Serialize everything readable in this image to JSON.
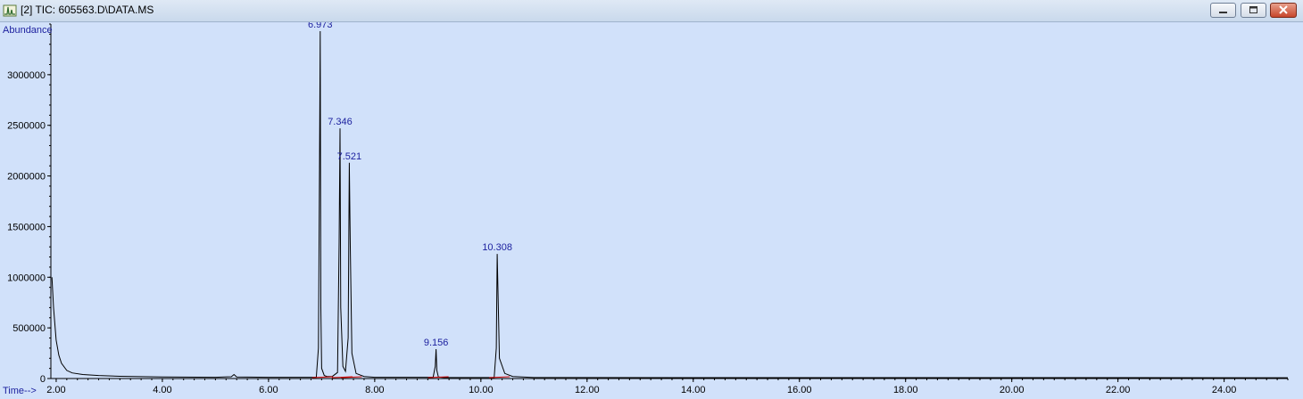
{
  "window": {
    "title": "[2] TIC: 605563.D\\DATA.MS",
    "icon": "chromatogram-app-icon",
    "controls": [
      "minimize",
      "restore",
      "close"
    ]
  },
  "colors": {
    "background": "#d1e1fa",
    "trace": "#000000",
    "labels": "#1b1f9e",
    "baseline_marks": "#cc0000"
  },
  "chart_data": {
    "type": "line",
    "title": "",
    "ylabel": "Abundance",
    "xlabel": "Time-->",
    "xlim": [
      1.9,
      25.2
    ],
    "ylim": [
      0,
      3500000
    ],
    "x_ticks": [
      "2.00",
      "4.00",
      "6.00",
      "8.00",
      "10.00",
      "12.00",
      "14.00",
      "16.00",
      "18.00",
      "20.00",
      "22.00",
      "24.00"
    ],
    "y_ticks": [
      "0",
      "500000",
      "1000000",
      "1500000",
      "2000000",
      "2500000",
      "3000000"
    ],
    "grid": false,
    "legend": "none",
    "peaks": [
      {
        "label": "6.973",
        "rt": 6.973,
        "height": 3430000
      },
      {
        "label": "7.346",
        "rt": 7.346,
        "height": 2470000
      },
      {
        "label": "7.521",
        "rt": 7.521,
        "height": 2130000
      },
      {
        "label": "9.156",
        "rt": 9.156,
        "height": 290000
      },
      {
        "label": "10.308",
        "rt": 10.308,
        "height": 1230000
      }
    ],
    "series": [
      {
        "x": [
          1.92,
          1.95,
          2.0,
          2.05,
          2.1,
          2.2,
          2.3,
          2.5,
          2.8,
          3.2,
          4.0,
          5.0,
          5.3,
          5.35,
          5.4,
          6.0,
          6.9,
          6.94,
          6.96,
          6.973,
          6.985,
          7.0,
          7.05,
          7.1,
          7.2,
          7.3,
          7.33,
          7.346,
          7.36,
          7.4,
          7.45,
          7.5,
          7.521,
          7.54,
          7.57,
          7.65,
          7.8,
          8.0,
          9.1,
          9.14,
          9.156,
          9.17,
          9.2,
          9.3,
          10.25,
          10.29,
          10.308,
          10.32,
          10.35,
          10.45,
          10.6,
          11.0,
          25.2
        ],
        "y": [
          1000000,
          700000,
          380000,
          230000,
          150000,
          80000,
          55000,
          40000,
          30000,
          22000,
          15000,
          12000,
          18000,
          40000,
          15000,
          12000,
          12000,
          300000,
          2080000,
          3430000,
          700000,
          100000,
          30000,
          20000,
          20000,
          60000,
          1350000,
          2470000,
          700000,
          120000,
          70000,
          400000,
          2130000,
          1300000,
          250000,
          50000,
          20000,
          12000,
          12000,
          120000,
          290000,
          80000,
          15000,
          10000,
          10000,
          300000,
          1230000,
          900000,
          200000,
          50000,
          20000,
          10000,
          8000
        ]
      }
    ]
  }
}
